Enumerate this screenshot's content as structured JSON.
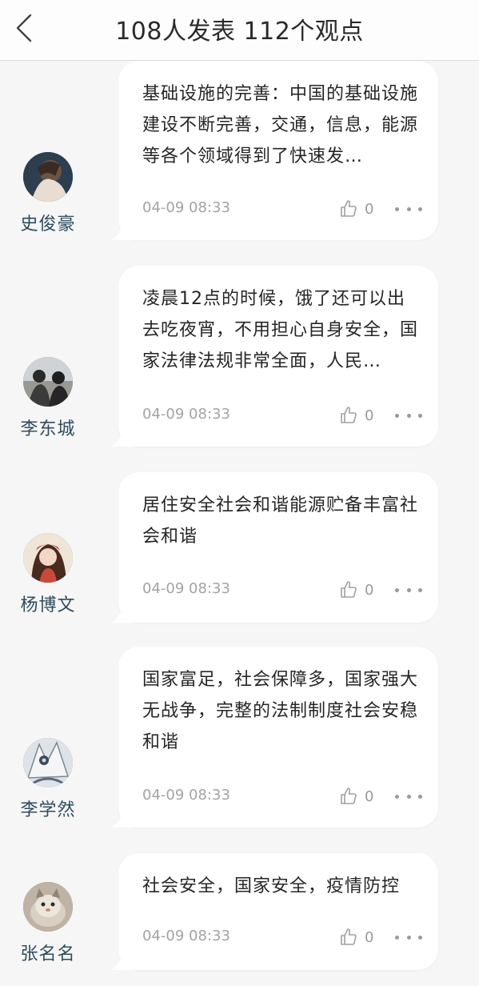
{
  "header": {
    "title": "108人发表  112个观点",
    "back_icon": "chevron-left-icon"
  },
  "colors": {
    "background": "#f6f6f6",
    "bubble": "#ffffff",
    "author_name": "#2e4c5e",
    "meta_text": "#a3a3a3"
  },
  "comments": [
    {
      "author": "史俊豪",
      "text": "基础设施的完善：中国的基础设施建设不断完善，交通，信息，能源等各个领域得到了快速发…",
      "time": "04-09 08:33",
      "likes": "0"
    },
    {
      "author": "李东城",
      "text": "凌晨12点的时候，饿了还可以出去吃夜宵，不用担心自身安全，国家法律法规非常全面，人民…",
      "time": "04-09 08:33",
      "likes": "0"
    },
    {
      "author": "杨博文",
      "text": "居住安全社会和谐能源贮备丰富社会和谐",
      "time": "04-09 08:33",
      "likes": "0"
    },
    {
      "author": "李学然",
      "text": "国家富足，社会保障多，国家强大无战争，完整的法制制度社会安稳和谐",
      "time": "04-09 08:33",
      "likes": "0"
    },
    {
      "author": "张名名",
      "text": "社会安全，国家安全，疫情防控",
      "time": "04-09 08:33",
      "likes": "0"
    }
  ]
}
